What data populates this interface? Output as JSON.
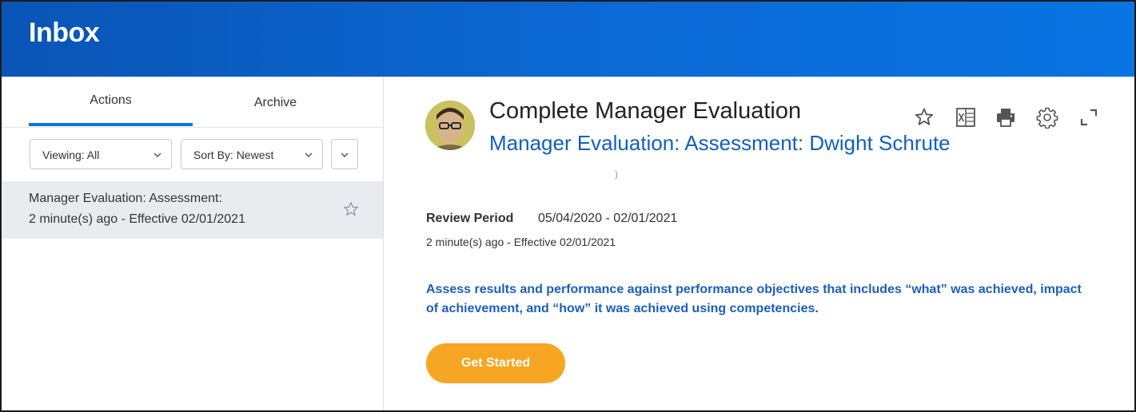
{
  "header": {
    "title": "Inbox"
  },
  "tabs": [
    {
      "label": "Actions",
      "active": true
    },
    {
      "label": "Archive",
      "active": false
    }
  ],
  "filters": {
    "viewing": {
      "label": "Viewing:",
      "value": "All"
    },
    "sort": {
      "label": "Sort By:",
      "value": "Newest"
    }
  },
  "inbox_items": [
    {
      "title": "Manager Evaluation: Assessment:",
      "subtitle": "2 minute(s) ago - Effective 02/01/2021",
      "icon": "star-outline-icon"
    }
  ],
  "detail": {
    "title": "Complete Manager Evaluation",
    "link": "Manager Evaluation: Assessment: Dwight Schrute",
    "stray_char": ")",
    "review_period_label": "Review Period",
    "review_period_value": "05/04/2020 - 02/01/2021",
    "meta": "2 minute(s) ago -  Effective 02/01/2021",
    "description": "Assess results and performance against performance objectives that includes “what” was achieved, impact of achievement, and “how” it was achieved using competencies.",
    "button_label": "Get Started"
  },
  "toolbar_icons": [
    "star-icon",
    "excel-export-icon",
    "print-icon",
    "gear-icon",
    "expand-icon"
  ],
  "colors": {
    "header_bg": "#0a6ad6",
    "accent_blue": "#0875e1",
    "link_blue": "#1060c0",
    "button_orange": "#f6a623",
    "selected_row": "#e9ecef"
  }
}
